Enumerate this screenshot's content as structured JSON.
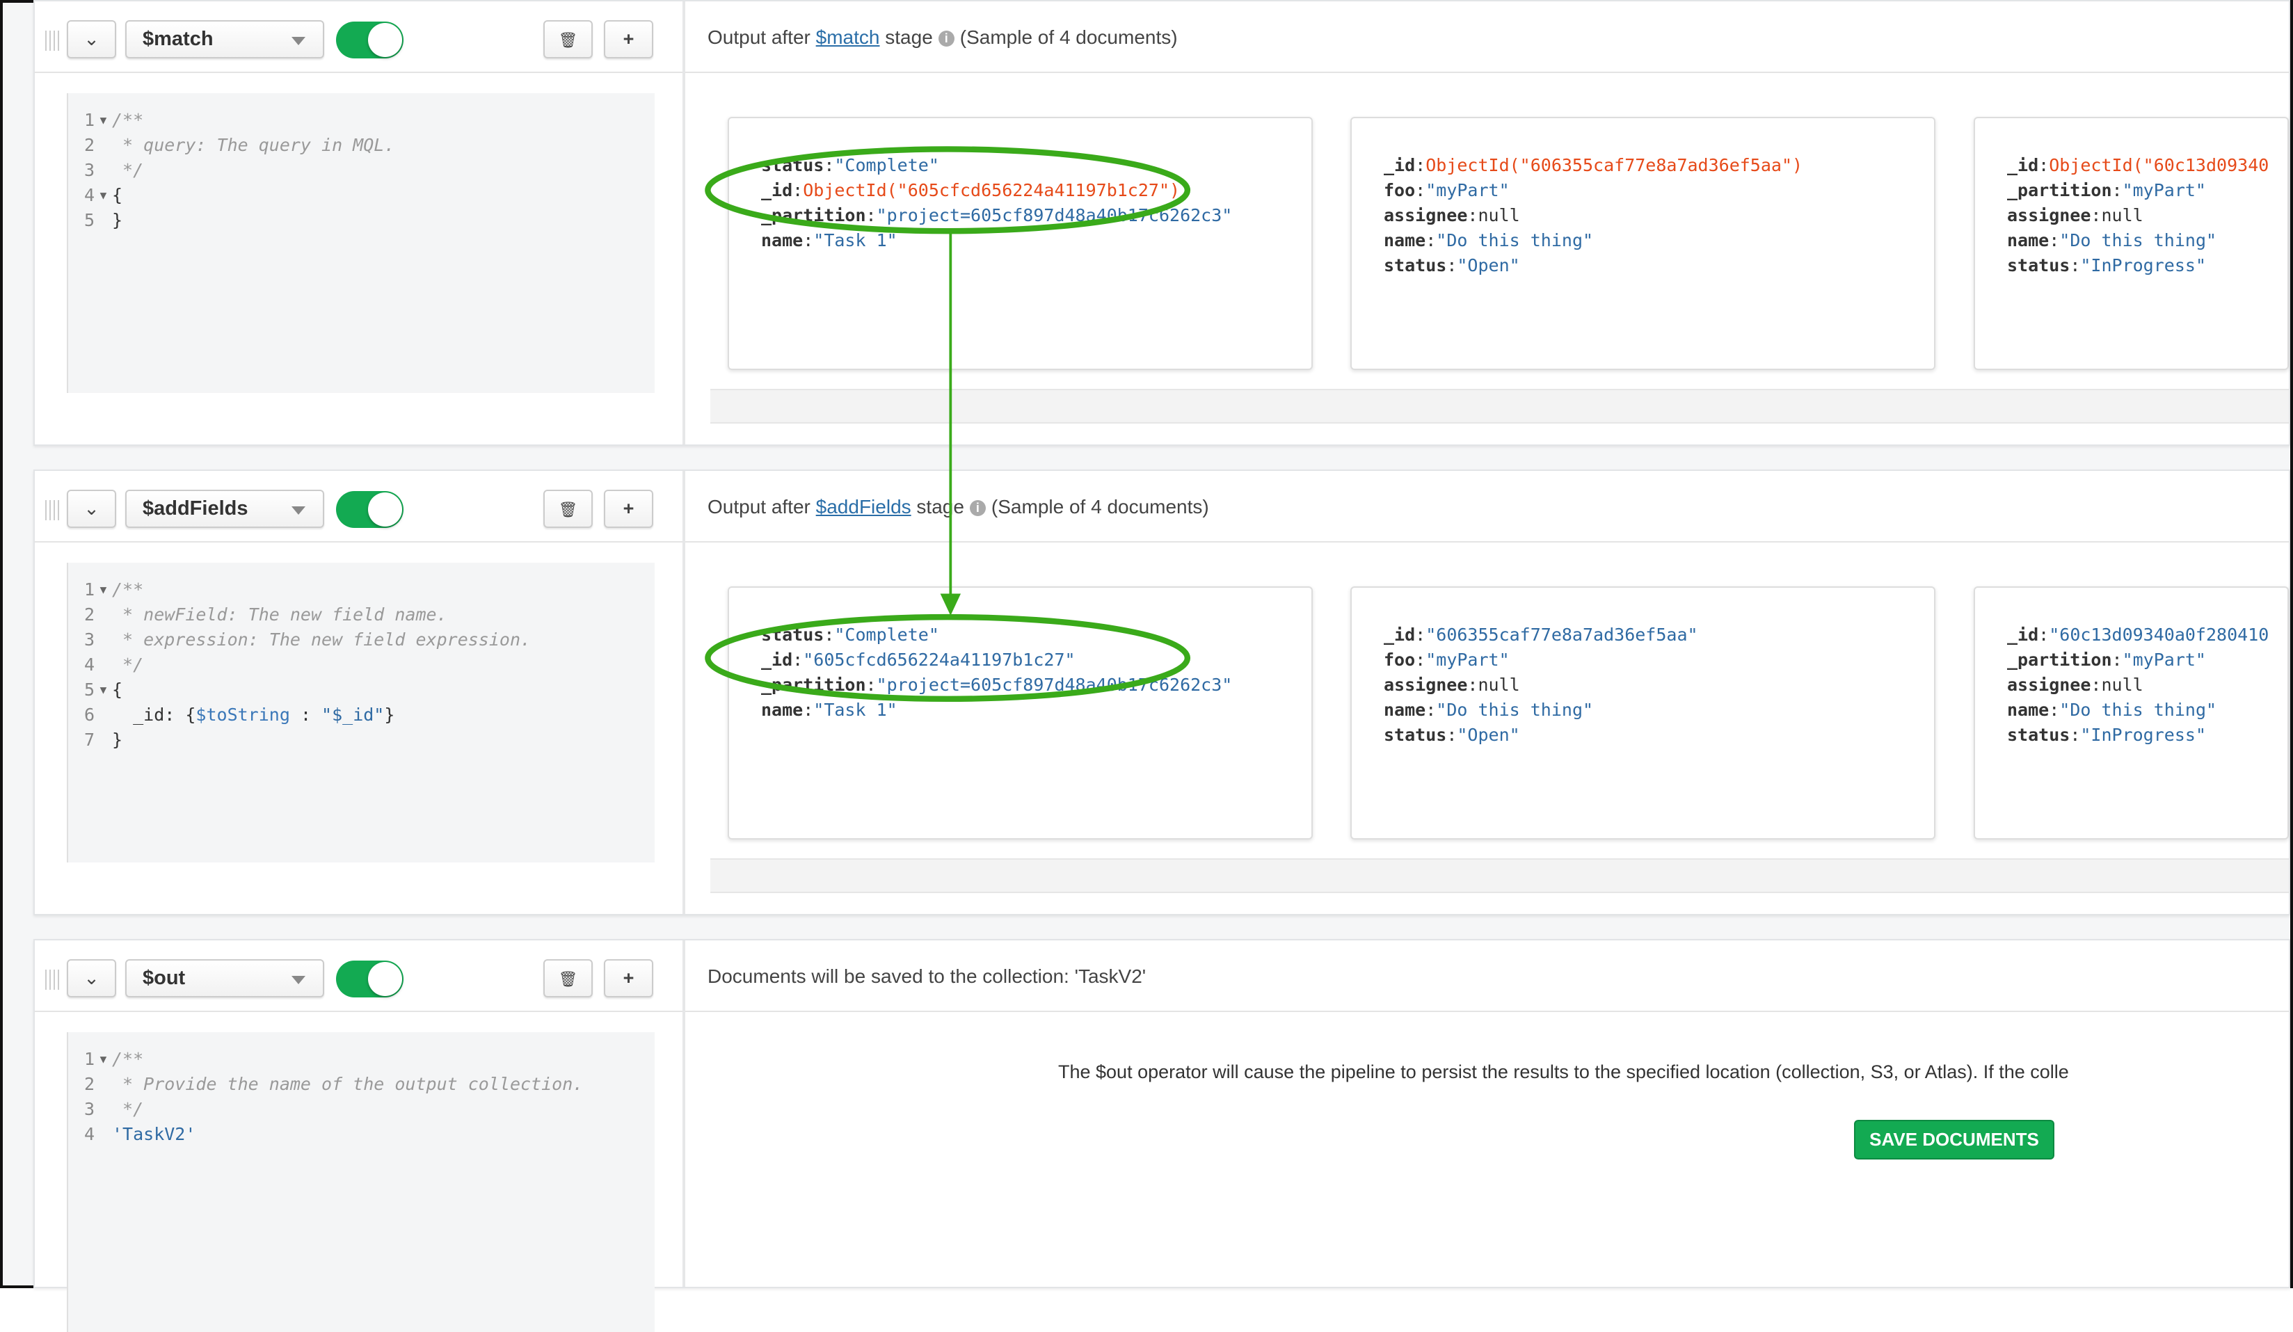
{
  "colors": {
    "accent": "#13aa52",
    "annotation": "#3aaa1a",
    "string": "#2f6aa3",
    "objectid": "#e64a19"
  },
  "icons": {
    "drag": "drag-handle-icon",
    "collapse": "chevron-down-icon",
    "delete": "trash-icon",
    "add": "plus-icon",
    "info": "info-icon"
  },
  "stages": [
    {
      "operator": "$match",
      "enabled": true,
      "output": {
        "prefix": "Output after",
        "link": "$match",
        "suffix": "stage",
        "sample": "(Sample of 4 documents)"
      },
      "code": [
        [
          {
            "t": "/**",
            "c": "comment"
          }
        ],
        [
          {
            "t": " * query: The query in MQL.",
            "c": "comment"
          }
        ],
        [
          {
            "t": " */",
            "c": "comment"
          }
        ],
        [
          {
            "t": "{",
            "c": "punct"
          }
        ],
        [
          {
            "t": "}",
            "c": "punct"
          }
        ]
      ],
      "documents": [
        [
          {
            "k": "status",
            "v": "\"Complete\"",
            "type": "string"
          },
          {
            "k": "_id",
            "v": "ObjectId(\"605cfcd656224a41197b1c27\")",
            "type": "oid"
          },
          {
            "k": "_partition",
            "v": "\"project=605cf897d48a40b17c6262c3\"",
            "type": "string"
          },
          {
            "k": "name",
            "v": "\"Task 1\"",
            "type": "string"
          }
        ],
        [
          {
            "k": "_id",
            "v": "ObjectId(\"606355caf77e8a7ad36ef5aa\")",
            "type": "oid"
          },
          {
            "k": "foo",
            "v": "\"myPart\"",
            "type": "string"
          },
          {
            "k": "assignee",
            "v": "null",
            "type": "null"
          },
          {
            "k": "name",
            "v": "\"Do this thing\"",
            "type": "string"
          },
          {
            "k": "status",
            "v": "\"Open\"",
            "type": "string"
          }
        ],
        [
          {
            "k": "_id",
            "v": "ObjectId(\"60c13d09340",
            "type": "oid"
          },
          {
            "k": "_partition",
            "v": "\"myPart\"",
            "type": "string"
          },
          {
            "k": "assignee",
            "v": "null",
            "type": "null"
          },
          {
            "k": "name",
            "v": "\"Do this thing\"",
            "type": "string"
          },
          {
            "k": "status",
            "v": "\"InProgress\"",
            "type": "string"
          }
        ]
      ]
    },
    {
      "operator": "$addFields",
      "enabled": true,
      "output": {
        "prefix": "Output after",
        "link": "$addFields",
        "suffix": "stage",
        "sample": "(Sample of 4 documents)"
      },
      "code": [
        [
          {
            "t": "/**",
            "c": "comment"
          }
        ],
        [
          {
            "t": " * newField: The new field name.",
            "c": "comment"
          }
        ],
        [
          {
            "t": " * expression: The new field expression.",
            "c": "comment"
          }
        ],
        [
          {
            "t": " */",
            "c": "comment"
          }
        ],
        [
          {
            "t": "{",
            "c": "punct"
          }
        ],
        [
          {
            "t": "  _id: {",
            "c": "key"
          },
          {
            "t": "$toString",
            "c": "op"
          },
          {
            "t": " : ",
            "c": "punct"
          },
          {
            "t": "\"$_id\"",
            "c": "str"
          },
          {
            "t": "}",
            "c": "punct"
          }
        ],
        [
          {
            "t": "}",
            "c": "punct"
          }
        ]
      ],
      "documents": [
        [
          {
            "k": "status",
            "v": "\"Complete\"",
            "type": "string"
          },
          {
            "k": "_id",
            "v": "\"605cfcd656224a41197b1c27\"",
            "type": "string"
          },
          {
            "k": "_partition",
            "v": "\"project=605cf897d48a40b17c6262c3\"",
            "type": "string"
          },
          {
            "k": "name",
            "v": "\"Task 1\"",
            "type": "string"
          }
        ],
        [
          {
            "k": "_id",
            "v": "\"606355caf77e8a7ad36ef5aa\"",
            "type": "string"
          },
          {
            "k": "foo",
            "v": "\"myPart\"",
            "type": "string"
          },
          {
            "k": "assignee",
            "v": "null",
            "type": "null"
          },
          {
            "k": "name",
            "v": "\"Do this thing\"",
            "type": "string"
          },
          {
            "k": "status",
            "v": "\"Open\"",
            "type": "string"
          }
        ],
        [
          {
            "k": "_id",
            "v": "\"60c13d09340a0f280410",
            "type": "string"
          },
          {
            "k": "_partition",
            "v": "\"myPart\"",
            "type": "string"
          },
          {
            "k": "assignee",
            "v": "null",
            "type": "null"
          },
          {
            "k": "name",
            "v": "\"Do this thing\"",
            "type": "string"
          },
          {
            "k": "status",
            "v": "\"InProgress\"",
            "type": "string"
          }
        ]
      ]
    },
    {
      "operator": "$out",
      "enabled": true,
      "output_text": "Documents will be saved to the collection: 'TaskV2'",
      "code": [
        [
          {
            "t": "/**",
            "c": "comment"
          }
        ],
        [
          {
            "t": " * Provide the name of the output collection.",
            "c": "comment"
          }
        ],
        [
          {
            "t": " */",
            "c": "comment"
          }
        ],
        [
          {
            "t": "'TaskV2'",
            "c": "str"
          }
        ]
      ],
      "message": "The $out operator will cause the pipeline to persist the results to the specified location (collection, S3, or Atlas). If the colle",
      "save_label": "SAVE DOCUMENTS"
    }
  ]
}
